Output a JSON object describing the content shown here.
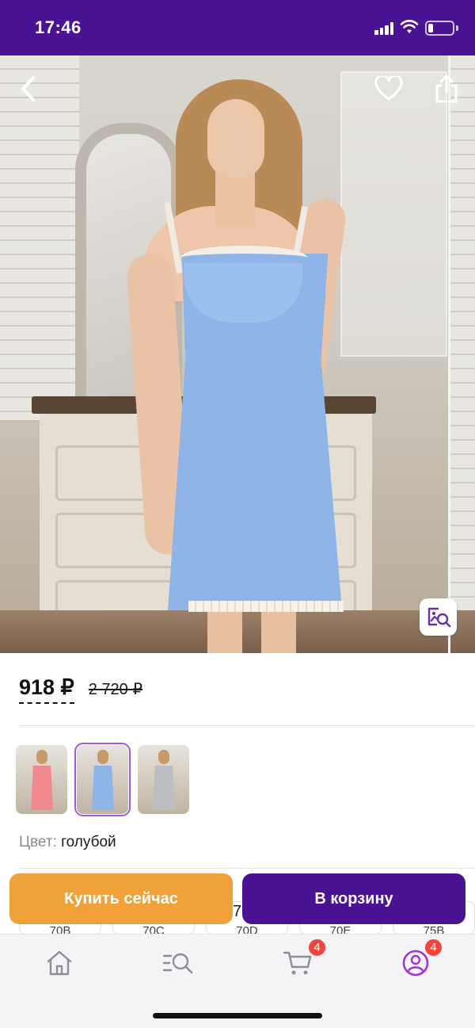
{
  "status_bar": {
    "time": "17:46",
    "icons": [
      "signal-icon",
      "wifi-icon",
      "battery-icon"
    ]
  },
  "header": {
    "back_icon": "chevron-left-icon",
    "favorite_icon": "heart-outline-icon",
    "share_icon": "share-icon"
  },
  "product": {
    "price_current": "918 ₽",
    "price_old": "2 720 ₽",
    "color_label": "Цвет:",
    "color_value": "голубой",
    "color_variants": [
      {
        "name": "pink",
        "swatch": "#f08a8f"
      },
      {
        "name": "голубой",
        "swatch": "#8fb5e8",
        "selected": true
      },
      {
        "name": "gray",
        "swatch": "#bdbec2"
      }
    ],
    "sizes": [
      "70B",
      "70C",
      "70D",
      "70E",
      "75B"
    ],
    "size_overlap_text": "70"
  },
  "actions": {
    "buy_now": "Купить сейчас",
    "add_to_cart": "В корзину"
  },
  "tab_bar": {
    "items": [
      {
        "icon": "home-icon"
      },
      {
        "icon": "search-catalog-icon"
      },
      {
        "icon": "cart-icon",
        "badge": "4"
      },
      {
        "icon": "profile-icon",
        "badge": "4",
        "active": true
      }
    ]
  },
  "colors": {
    "brand_purple": "#4a1394",
    "accent_orange": "#f0a13a",
    "active_tab": "#a234d6",
    "badge_red": "#f2443c"
  }
}
